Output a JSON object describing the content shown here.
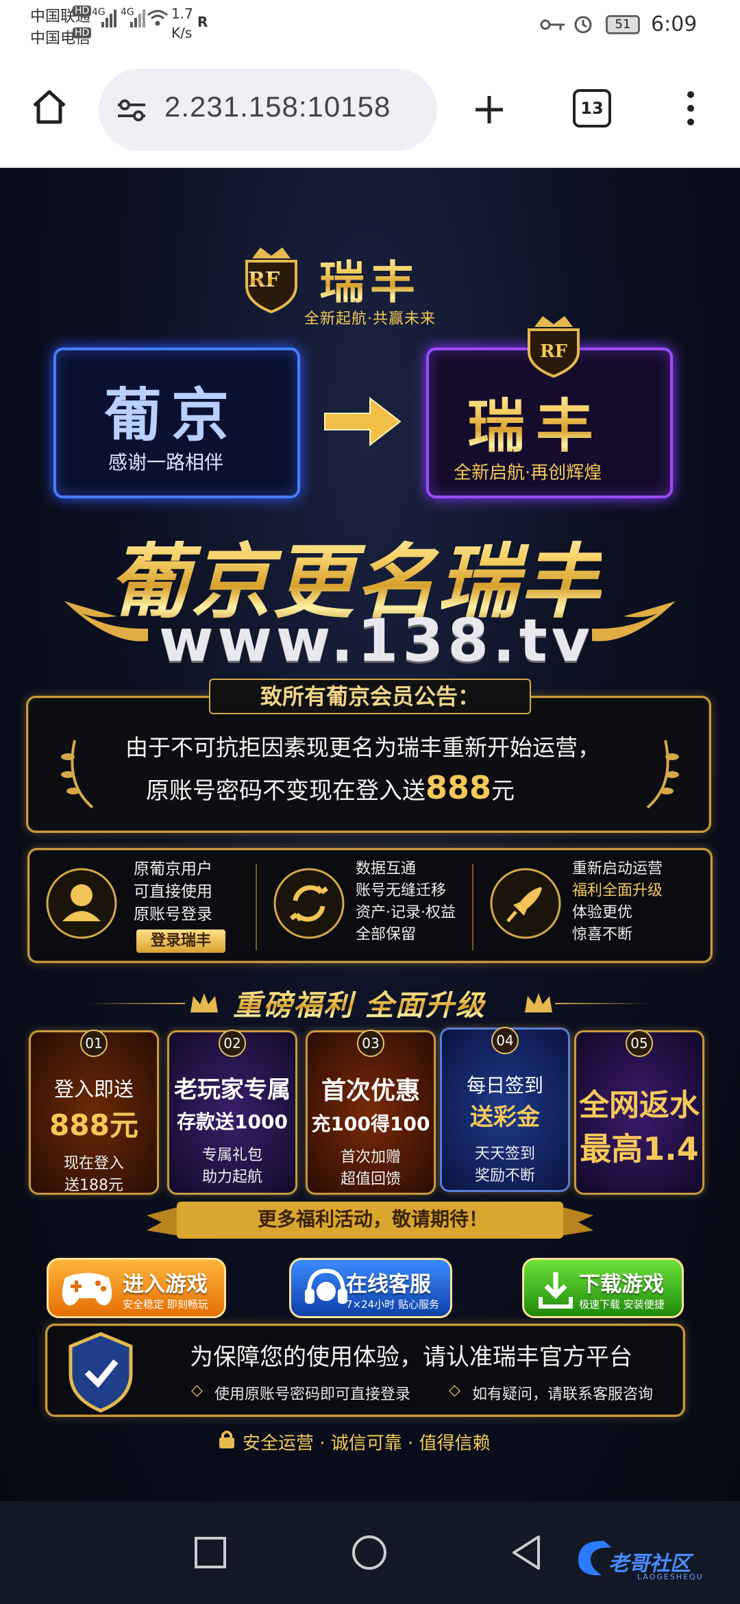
{
  "status_bar": {
    "carrier1": "中国联通",
    "carrier2": "中国电信",
    "hd": "HD",
    "net": "4G",
    "speed_value": "1.7",
    "speed_unit": "K/s",
    "r": "R",
    "battery": "51",
    "time": "6:09"
  },
  "browser": {
    "url": "2.231.158:10158",
    "tab_count": "13",
    "icons": [
      "home-icon",
      "site-settings-icon",
      "plus-icon",
      "tabs-icon",
      "more-vertical-icon"
    ]
  },
  "brand": {
    "logo": "RF",
    "name": "瑞丰",
    "slogan": "全新起航·共赢未来"
  },
  "transition": {
    "from_name": "葡京",
    "from_sub": "感谢一路相伴",
    "to_name": "瑞丰",
    "to_sub": "全新启航·再创辉煌"
  },
  "headline": "葡京更名瑞丰",
  "domain": "www.138.tv",
  "notice": {
    "title": "致所有葡京会员公告：",
    "line1": "由于不可抗拒因素现更名为瑞丰重新开始运营，",
    "line2_a": "原账号密码不变现在登入送",
    "line2_amount": "888",
    "line2_b": "元"
  },
  "features": [
    {
      "icon": "user-icon",
      "lines": [
        "原葡京用户",
        "可直接使用",
        "原账号登录"
      ],
      "button": "登录瑞丰"
    },
    {
      "icon": "sync-icon",
      "lines": [
        "数据互通",
        "账号无缝迁移",
        "资产·记录·权益",
        "全部保留"
      ]
    },
    {
      "icon": "rocket-icon",
      "lines": [
        "重新启动运营",
        "福利全面升级",
        "体验更优",
        "惊喜不断"
      ]
    }
  ],
  "benefits_title": "重磅福利 全面升级",
  "cards": [
    {
      "num": "01",
      "a": "登入即送",
      "b": "888元",
      "c": "现在登入",
      "d": "送188元"
    },
    {
      "num": "02",
      "a": "老玩家专属",
      "b": "存款送1000",
      "c": "专属礼包",
      "d": "助力起航"
    },
    {
      "num": "03",
      "a": "首次优惠",
      "b": "充100得100",
      "c": "首次加赠",
      "d": "超值回馈"
    },
    {
      "num": "04",
      "a": "每日签到",
      "b": "送彩金",
      "c": "天天签到",
      "d": "奖励不断"
    },
    {
      "num": "05",
      "a": "全网返水",
      "b": "最高1.4"
    }
  ],
  "more_banner": "更多福利活动，敬请期待！",
  "buttons": [
    {
      "label": "进入游戏",
      "sub": "安全稳定 即刻畅玩",
      "icon": "gamepad-icon"
    },
    {
      "label": "在线客服",
      "sub": "7×24小时 贴心服务",
      "icon": "headset-icon"
    },
    {
      "label": "下载游戏",
      "sub": "极速下载 安装便捷",
      "icon": "download-icon"
    }
  ],
  "security": {
    "title": "为保障您的使用体验，请认准瑞丰官方平台",
    "point1": "使用原账号密码即可直接登录",
    "point2": "如有疑问，请联系客服咨询"
  },
  "footer": "安全运营 · 诚信可靠 · 值得信赖",
  "watermark": {
    "name": "老哥社区",
    "sub": "LAOGESHEQU"
  },
  "colors": {
    "gold": "#f4c95a",
    "blue_frame": "#4a7dff",
    "purple_frame": "#9c4dff",
    "green_button": "#3cb11d",
    "blue_button": "#1b63d8",
    "orange_button": "#f08a0c"
  }
}
